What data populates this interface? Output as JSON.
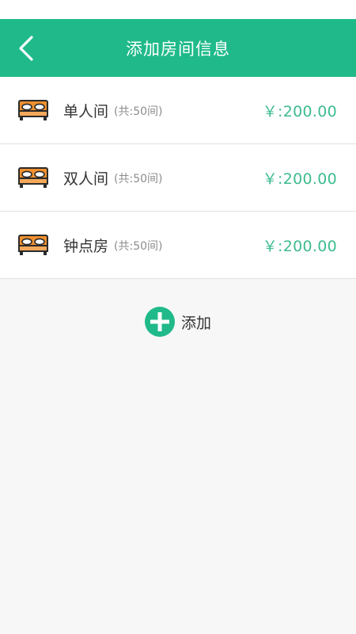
{
  "header": {
    "title": "添加房间信息"
  },
  "rooms": [
    {
      "name": "单人间",
      "count": "(共:50间)",
      "price": "￥:200.00"
    },
    {
      "name": "双人间",
      "count": "(共:50间)",
      "price": "￥:200.00"
    },
    {
      "name": "钟点房",
      "count": "(共:50间)",
      "price": "￥:200.00"
    }
  ],
  "add": {
    "label": "添加"
  },
  "colors": {
    "accent": "#20ba8a",
    "price": "#3dbc8e",
    "bed_frame": "#f0902e",
    "background": "#f7f7f7"
  },
  "icons": {
    "back": "chevron-left-icon",
    "bed": "bed-icon",
    "add": "plus-circle-icon"
  }
}
